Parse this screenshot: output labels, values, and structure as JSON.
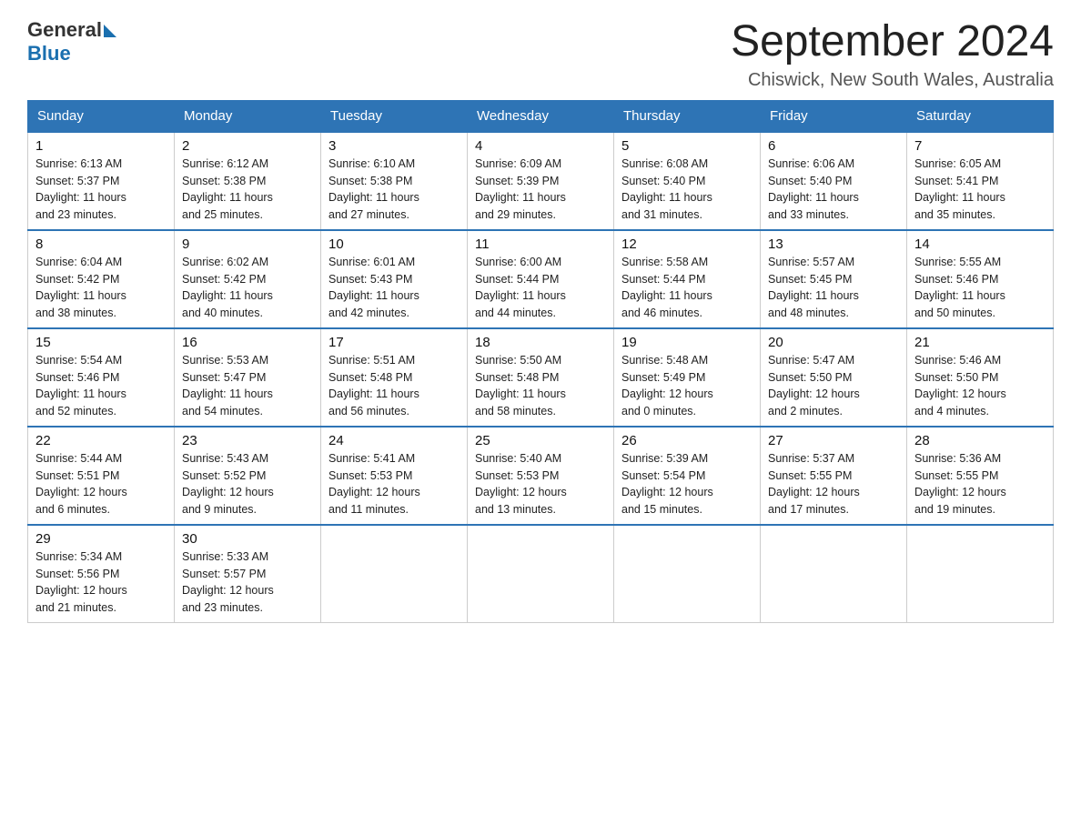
{
  "header": {
    "logo_general": "General",
    "logo_blue": "Blue",
    "month_title": "September 2024",
    "location": "Chiswick, New South Wales, Australia"
  },
  "days_of_week": [
    "Sunday",
    "Monday",
    "Tuesday",
    "Wednesday",
    "Thursday",
    "Friday",
    "Saturday"
  ],
  "weeks": [
    [
      {
        "day": "1",
        "sunrise": "6:13 AM",
        "sunset": "5:37 PM",
        "daylight": "11 hours and 23 minutes."
      },
      {
        "day": "2",
        "sunrise": "6:12 AM",
        "sunset": "5:38 PM",
        "daylight": "11 hours and 25 minutes."
      },
      {
        "day": "3",
        "sunrise": "6:10 AM",
        "sunset": "5:38 PM",
        "daylight": "11 hours and 27 minutes."
      },
      {
        "day": "4",
        "sunrise": "6:09 AM",
        "sunset": "5:39 PM",
        "daylight": "11 hours and 29 minutes."
      },
      {
        "day": "5",
        "sunrise": "6:08 AM",
        "sunset": "5:40 PM",
        "daylight": "11 hours and 31 minutes."
      },
      {
        "day": "6",
        "sunrise": "6:06 AM",
        "sunset": "5:40 PM",
        "daylight": "11 hours and 33 minutes."
      },
      {
        "day": "7",
        "sunrise": "6:05 AM",
        "sunset": "5:41 PM",
        "daylight": "11 hours and 35 minutes."
      }
    ],
    [
      {
        "day": "8",
        "sunrise": "6:04 AM",
        "sunset": "5:42 PM",
        "daylight": "11 hours and 38 minutes."
      },
      {
        "day": "9",
        "sunrise": "6:02 AM",
        "sunset": "5:42 PM",
        "daylight": "11 hours and 40 minutes."
      },
      {
        "day": "10",
        "sunrise": "6:01 AM",
        "sunset": "5:43 PM",
        "daylight": "11 hours and 42 minutes."
      },
      {
        "day": "11",
        "sunrise": "6:00 AM",
        "sunset": "5:44 PM",
        "daylight": "11 hours and 44 minutes."
      },
      {
        "day": "12",
        "sunrise": "5:58 AM",
        "sunset": "5:44 PM",
        "daylight": "11 hours and 46 minutes."
      },
      {
        "day": "13",
        "sunrise": "5:57 AM",
        "sunset": "5:45 PM",
        "daylight": "11 hours and 48 minutes."
      },
      {
        "day": "14",
        "sunrise": "5:55 AM",
        "sunset": "5:46 PM",
        "daylight": "11 hours and 50 minutes."
      }
    ],
    [
      {
        "day": "15",
        "sunrise": "5:54 AM",
        "sunset": "5:46 PM",
        "daylight": "11 hours and 52 minutes."
      },
      {
        "day": "16",
        "sunrise": "5:53 AM",
        "sunset": "5:47 PM",
        "daylight": "11 hours and 54 minutes."
      },
      {
        "day": "17",
        "sunrise": "5:51 AM",
        "sunset": "5:48 PM",
        "daylight": "11 hours and 56 minutes."
      },
      {
        "day": "18",
        "sunrise": "5:50 AM",
        "sunset": "5:48 PM",
        "daylight": "11 hours and 58 minutes."
      },
      {
        "day": "19",
        "sunrise": "5:48 AM",
        "sunset": "5:49 PM",
        "daylight": "12 hours and 0 minutes."
      },
      {
        "day": "20",
        "sunrise": "5:47 AM",
        "sunset": "5:50 PM",
        "daylight": "12 hours and 2 minutes."
      },
      {
        "day": "21",
        "sunrise": "5:46 AM",
        "sunset": "5:50 PM",
        "daylight": "12 hours and 4 minutes."
      }
    ],
    [
      {
        "day": "22",
        "sunrise": "5:44 AM",
        "sunset": "5:51 PM",
        "daylight": "12 hours and 6 minutes."
      },
      {
        "day": "23",
        "sunrise": "5:43 AM",
        "sunset": "5:52 PM",
        "daylight": "12 hours and 9 minutes."
      },
      {
        "day": "24",
        "sunrise": "5:41 AM",
        "sunset": "5:53 PM",
        "daylight": "12 hours and 11 minutes."
      },
      {
        "day": "25",
        "sunrise": "5:40 AM",
        "sunset": "5:53 PM",
        "daylight": "12 hours and 13 minutes."
      },
      {
        "day": "26",
        "sunrise": "5:39 AM",
        "sunset": "5:54 PM",
        "daylight": "12 hours and 15 minutes."
      },
      {
        "day": "27",
        "sunrise": "5:37 AM",
        "sunset": "5:55 PM",
        "daylight": "12 hours and 17 minutes."
      },
      {
        "day": "28",
        "sunrise": "5:36 AM",
        "sunset": "5:55 PM",
        "daylight": "12 hours and 19 minutes."
      }
    ],
    [
      {
        "day": "29",
        "sunrise": "5:34 AM",
        "sunset": "5:56 PM",
        "daylight": "12 hours and 21 minutes."
      },
      {
        "day": "30",
        "sunrise": "5:33 AM",
        "sunset": "5:57 PM",
        "daylight": "12 hours and 23 minutes."
      },
      null,
      null,
      null,
      null,
      null
    ]
  ],
  "labels": {
    "sunrise": "Sunrise:",
    "sunset": "Sunset:",
    "daylight": "Daylight:"
  }
}
